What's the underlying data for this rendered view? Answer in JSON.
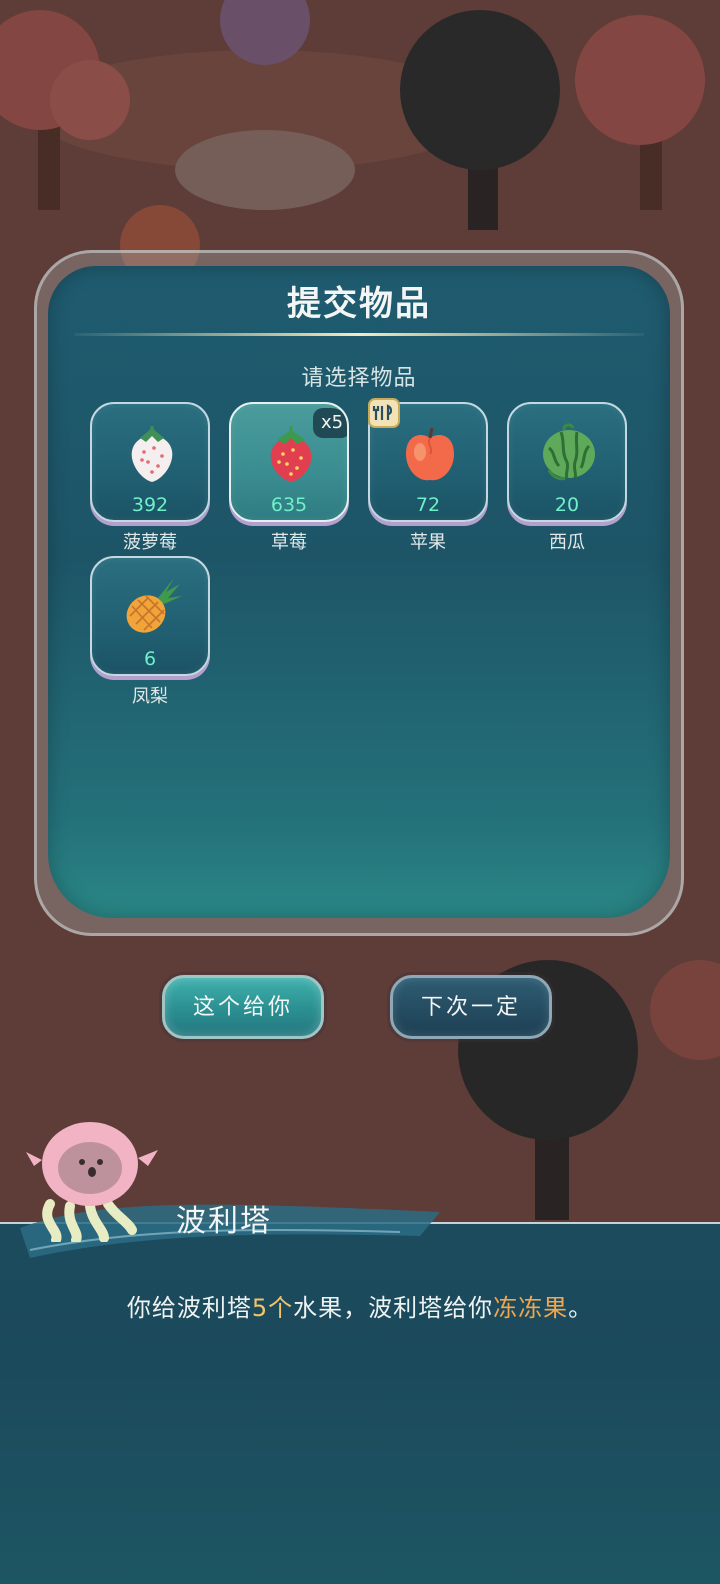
{
  "panel": {
    "title": "提交物品",
    "subtitle": "请选择物品"
  },
  "items": [
    {
      "name": "菠萝莓",
      "count": "392",
      "icon": "white-strawberry-icon"
    },
    {
      "name": "草莓",
      "count": "635",
      "icon": "strawberry-icon",
      "selected_badge": "x5"
    },
    {
      "name": "苹果",
      "count": "72",
      "icon": "apple-icon",
      "badge_icon": "fork-knife-icon"
    },
    {
      "name": "西瓜",
      "count": "20",
      "icon": "watermelon-icon"
    },
    {
      "name": "凤梨",
      "count": "6",
      "icon": "pineapple-icon"
    }
  ],
  "buttons": {
    "give": "这个给你",
    "later": "下次一定"
  },
  "dialog": {
    "speaker": "波利塔",
    "line_part1": "你给波利塔",
    "line_number": "5个",
    "line_part2": "水果，波利塔给你",
    "line_item": "冻冻果",
    "line_end": "。"
  },
  "colors": {
    "count_text": "#6ff0c8",
    "highlight_number": "#f2c46b",
    "highlight_item": "#f2a64e",
    "panel_teal": "#1f5b6f"
  }
}
